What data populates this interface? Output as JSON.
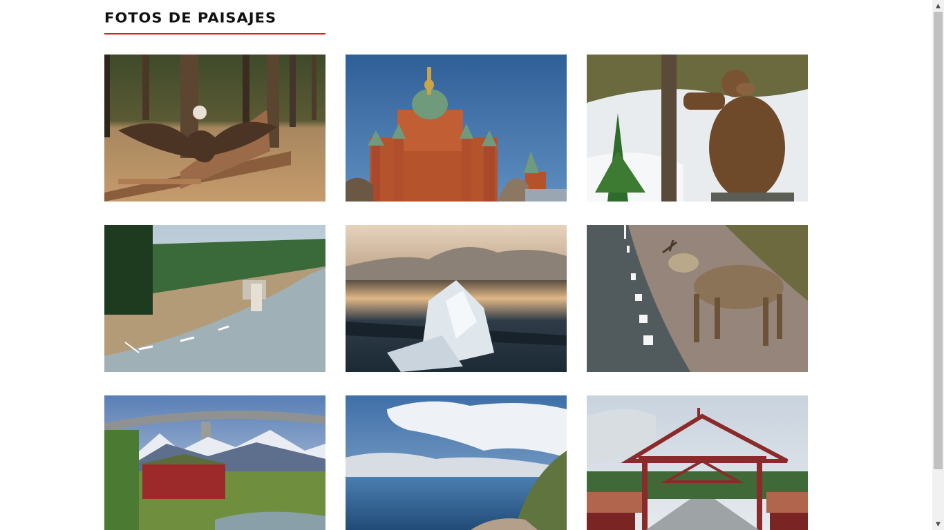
{
  "page": {
    "title": "FOTOS DE PAISAJES"
  },
  "colors": {
    "heading_underline": "#d32222",
    "background": "#ffffff"
  },
  "gallery": {
    "photos": [
      {
        "subject": "carved-eagle-bench-in-forest"
      },
      {
        "subject": "red-brick-cathedral-with-green-domes"
      },
      {
        "subject": "brown-bear-standing-by-tree-in-snow"
      },
      {
        "subject": "reindeer-on-winding-road"
      },
      {
        "subject": "ice-chunk-on-lake-at-sunset"
      },
      {
        "subject": "reindeer-crossing-road"
      },
      {
        "subject": "red-boathouse-under-bridge-mountains"
      },
      {
        "subject": "fjord-view-with-clouds"
      },
      {
        "subject": "red-wooden-bridge-gate"
      }
    ]
  },
  "scrollbar": {
    "up_icon": "triangle-up",
    "down_icon": "triangle-down"
  }
}
